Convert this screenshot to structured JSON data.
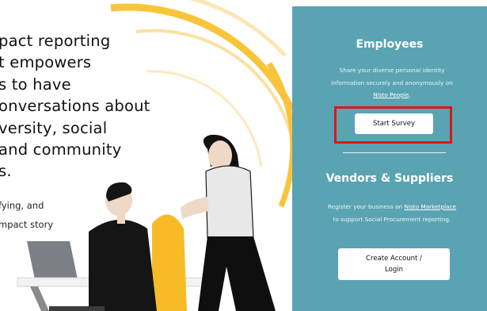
{
  "hero": {
    "headline": "pact reporting\nt empowers\ns to have\nonversations about\nversity, social\n and community\ns.",
    "body": "fying, and\nmpact story"
  },
  "employees": {
    "title": "Employees",
    "desc_text": "Share your diverse personal identity information securely and anonymously on ",
    "desc_link": "Nisto People",
    "desc_end": ".",
    "button_label": "Start Survey"
  },
  "vendors": {
    "title": "Vendors & Suppliers",
    "desc_text": "Register your business on ",
    "desc_link": "Nisto Marketplace",
    "desc_end": " to support Social Procurement reporting.",
    "button_label": "Create Account / Login"
  },
  "colors": {
    "panel_bg": "#5aa3b2",
    "accent_yellow": "#f8c43a",
    "highlight_red": "#e0141a"
  }
}
